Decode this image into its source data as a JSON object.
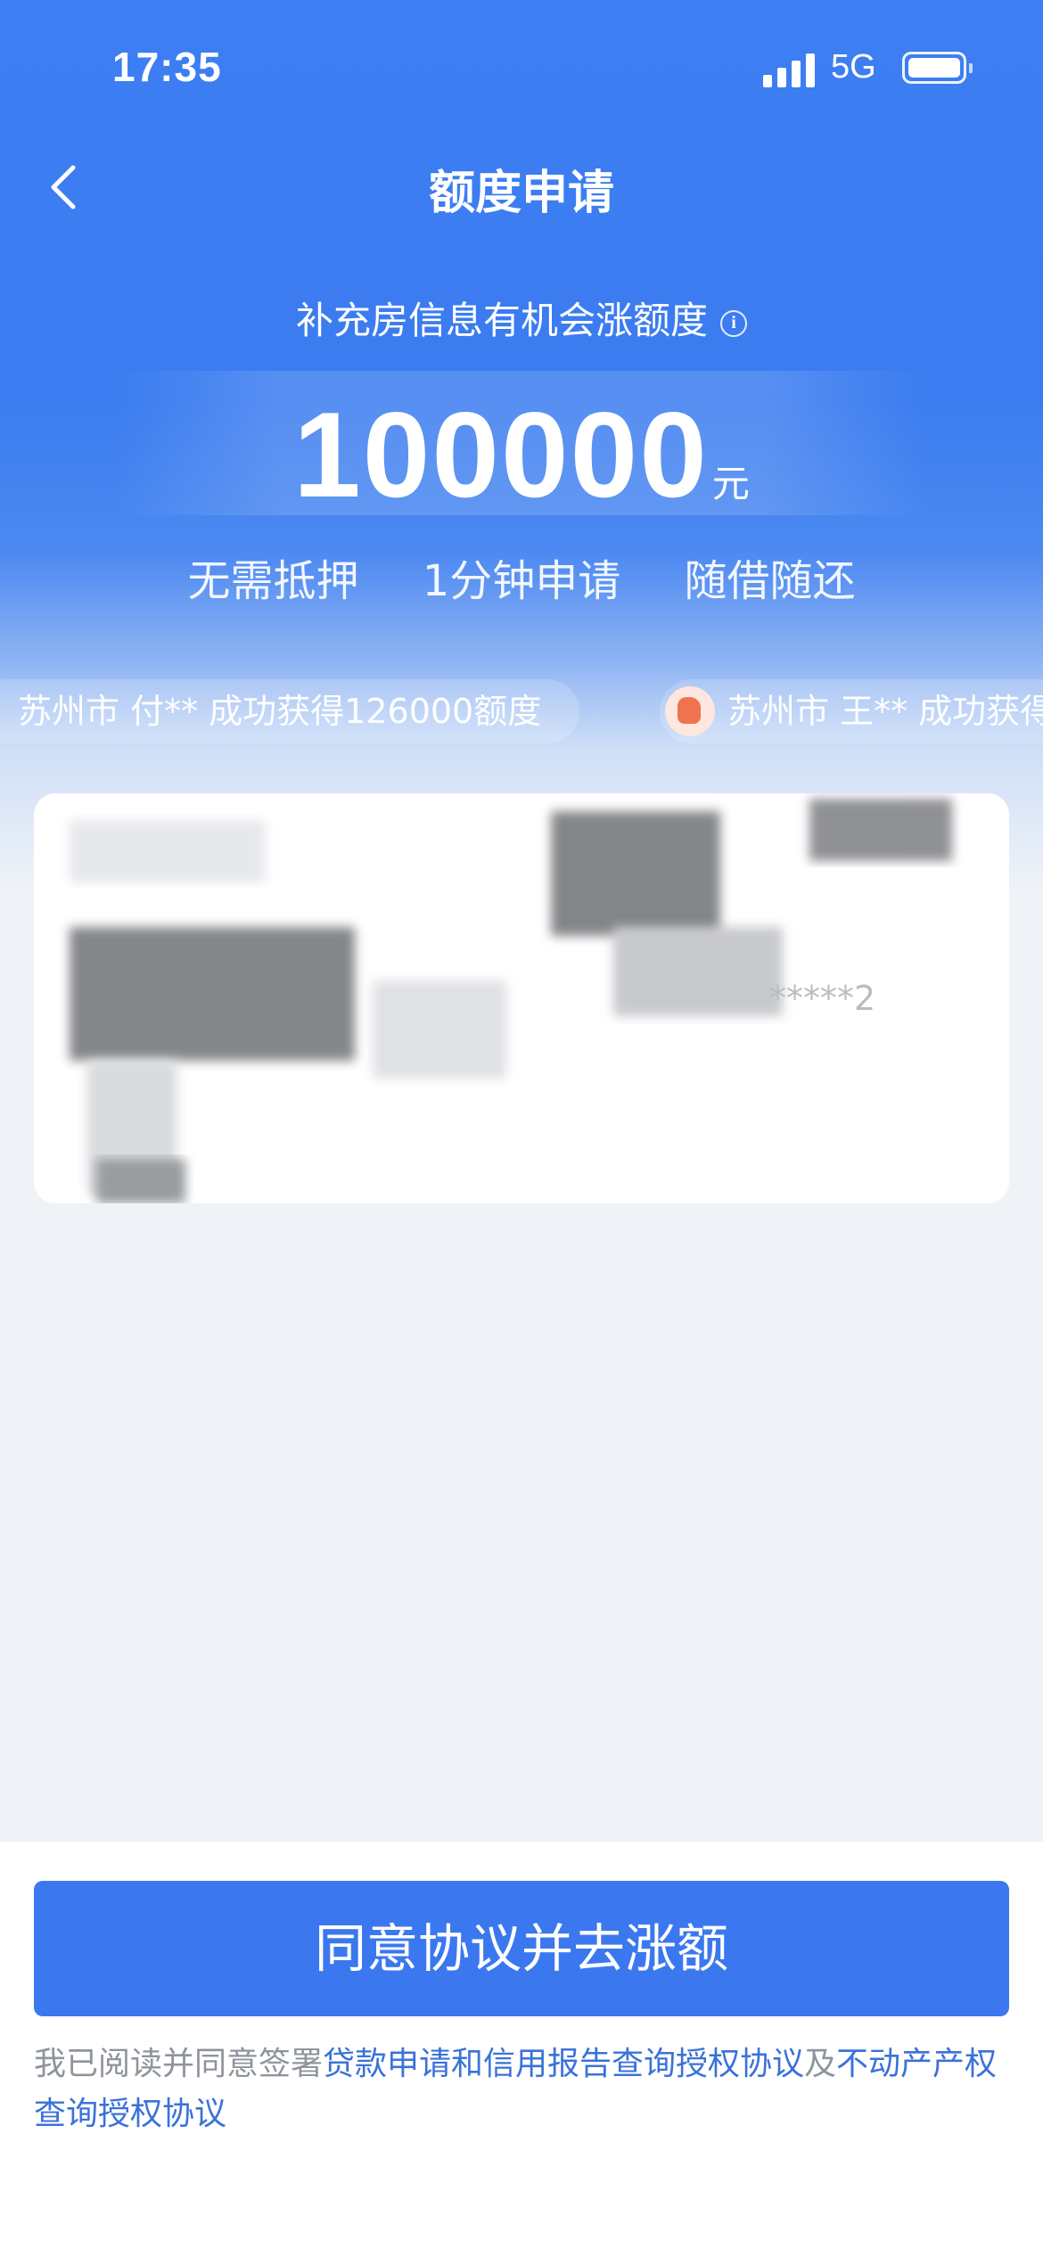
{
  "status_bar": {
    "time": "17:35",
    "network": "5G"
  },
  "nav": {
    "title": "额度申请"
  },
  "header": {
    "subtitle": "补充房信息有机会涨额度",
    "amount": "100000",
    "unit": "元",
    "features": [
      "无需抵押",
      "1分钟申请",
      "随借随还"
    ]
  },
  "ticker": [
    {
      "text": "苏州市 付** 成功获得126000额度"
    },
    {
      "text": "苏州市 王** 成功获得"
    }
  ],
  "form": {
    "partial_text": "*****2"
  },
  "footer": {
    "button_label": "同意协议并去涨额",
    "agreement_prefix": "我已阅读并同意签署",
    "link1": "贷款申请和信用报告查询授权协议",
    "connector": "及",
    "link2": "不动产产权查询授权协议"
  },
  "colors": {
    "brand_blue": "#3b7cf0",
    "button_blue": "#3b78f0",
    "link_blue": "#3b72d9",
    "page_bg": "#eff3f8"
  }
}
